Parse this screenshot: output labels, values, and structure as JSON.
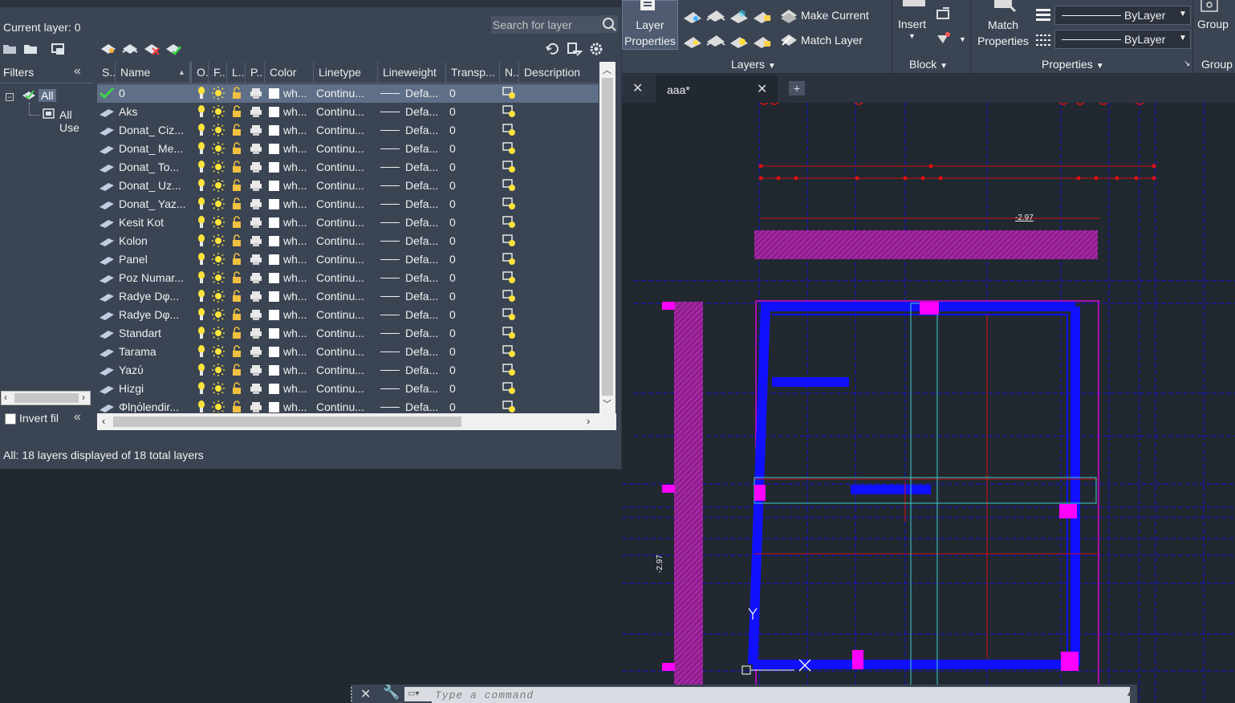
{
  "palette": {
    "current_layer": "Current layer: 0",
    "search_placeholder": "Search for layer",
    "filters_label": "Filters",
    "tree": {
      "all": "All",
      "all_used": "All Use"
    },
    "invert_filter": "Invert fil",
    "status": "All: 18 layers displayed of 18 total layers",
    "columns": [
      "S..",
      "Name",
      "O..",
      "F...",
      "L...",
      "P..",
      "Color",
      "Linetype",
      "Lineweight",
      "Transp...",
      "N..",
      "Description"
    ],
    "layers": [
      {
        "name": "0",
        "color": "wh...",
        "linetype": "Continu...",
        "lineweight": "Defa...",
        "transparency": "0",
        "current": true
      },
      {
        "name": "Aks",
        "color": "wh...",
        "linetype": "Continu...",
        "lineweight": "Defa...",
        "transparency": "0"
      },
      {
        "name": "Donat_ Ciz...",
        "color": "wh...",
        "linetype": "Continu...",
        "lineweight": "Defa...",
        "transparency": "0"
      },
      {
        "name": "Donat_ Me...",
        "color": "wh...",
        "linetype": "Continu...",
        "lineweight": "Defa...",
        "transparency": "0"
      },
      {
        "name": "Donat_ To...",
        "color": "wh...",
        "linetype": "Continu...",
        "lineweight": "Defa...",
        "transparency": "0"
      },
      {
        "name": "Donat_ Uz...",
        "color": "wh...",
        "linetype": "Continu...",
        "lineweight": "Defa...",
        "transparency": "0"
      },
      {
        "name": "Donat_ Yaz...",
        "color": "wh...",
        "linetype": "Continu...",
        "lineweight": "Defa...",
        "transparency": "0"
      },
      {
        "name": "Kesit Kot",
        "color": "wh...",
        "linetype": "Continu...",
        "lineweight": "Defa...",
        "transparency": "0"
      },
      {
        "name": "Kolon",
        "color": "wh...",
        "linetype": "Continu...",
        "lineweight": "Defa...",
        "transparency": "0"
      },
      {
        "name": "Panel",
        "color": "wh...",
        "linetype": "Continu...",
        "lineweight": "Defa...",
        "transparency": "0"
      },
      {
        "name": "Poz Numar...",
        "color": "wh...",
        "linetype": "Continu...",
        "lineweight": "Defa...",
        "transparency": "0"
      },
      {
        "name": "Radye Dφ...",
        "color": "wh...",
        "linetype": "Continu...",
        "lineweight": "Defa...",
        "transparency": "0"
      },
      {
        "name": "Radye Dφ...",
        "color": "wh...",
        "linetype": "Continu...",
        "lineweight": "Defa...",
        "transparency": "0"
      },
      {
        "name": "Standart",
        "color": "wh...",
        "linetype": "Continu...",
        "lineweight": "Defa...",
        "transparency": "0"
      },
      {
        "name": "Tarama",
        "color": "wh...",
        "linetype": "Continu...",
        "lineweight": "Defa...",
        "transparency": "0"
      },
      {
        "name": "Yazύ",
        "color": "wh...",
        "linetype": "Continu...",
        "lineweight": "Defa...",
        "transparency": "0"
      },
      {
        "name": "Hizgi",
        "color": "wh...",
        "linetype": "Continu...",
        "lineweight": "Defa...",
        "transparency": "0"
      },
      {
        "name": "Φlηόlendir...",
        "color": "wh...",
        "linetype": "Continu...",
        "lineweight": "Defa...",
        "transparency": "0"
      }
    ]
  },
  "ribbon": {
    "layer_properties": [
      "Layer",
      "Properties"
    ],
    "make_current": "Make Current",
    "match_layer": "Match Layer",
    "insert": "Insert",
    "match_properties": [
      "Match",
      "Properties"
    ],
    "bylayer_1": "ByLayer",
    "bylayer_2": "ByLayer",
    "group": "Group",
    "panels": {
      "layers": "Layers",
      "block": "Block",
      "properties": "Properties",
      "group": "Group"
    }
  },
  "tabs": [
    {
      "label": "aaa*"
    }
  ],
  "drawing": {
    "elev_top": "-2.97",
    "elev_left": "-2.97"
  },
  "command": {
    "placeholder": "Type a command"
  },
  "colors": {
    "layer_bg": "#5f6f88",
    "accent_blue": "#0000ff",
    "magenta": "#ff00ff",
    "red": "#ff0000",
    "cyan": "#3fd0d0"
  }
}
